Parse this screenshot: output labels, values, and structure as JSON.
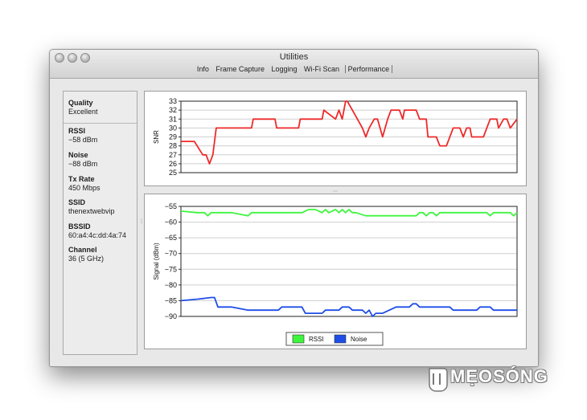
{
  "window": {
    "title": "Utilities",
    "tabs": [
      "Info",
      "Frame Capture",
      "Logging",
      "Wi-Fi Scan",
      "Performance"
    ],
    "active_tab": "Performance"
  },
  "sidebar": {
    "quality": {
      "label": "Quality",
      "value": "Excellent"
    },
    "items": [
      {
        "label": "RSSI",
        "value": "−58 dBm"
      },
      {
        "label": "Noise",
        "value": "−88 dBm"
      },
      {
        "label": "Tx Rate",
        "value": "450 Mbps"
      },
      {
        "label": "SSID",
        "value": "thenextwebvip"
      },
      {
        "label": "BSSID",
        "value": "60:a4:4c:dd:4a:74"
      },
      {
        "label": "Channel",
        "value": "36 (5 GHz)"
      }
    ]
  },
  "chart_data": [
    {
      "type": "line",
      "ylabel": "SNR",
      "ylim": [
        25,
        33
      ],
      "yticks": [
        25,
        26,
        27,
        28,
        29,
        30,
        31,
        32,
        33
      ],
      "grid": true,
      "series": [
        {
          "color": "#ee2a2a",
          "x": [
            0,
            4,
            6.5,
            7.5,
            8.5,
            9.5,
            10.5,
            14,
            21,
            21.5,
            28,
            28.5,
            35,
            35.5,
            42,
            42.5,
            46,
            47,
            48,
            49,
            49.5,
            51,
            52.5,
            54,
            55,
            56,
            57.5,
            58.5,
            60,
            61.5,
            62.5,
            64,
            65,
            66,
            66.5,
            70,
            71,
            73,
            73.5,
            76,
            77,
            79,
            81,
            81.5,
            83,
            84,
            85,
            86,
            86.5,
            90,
            91,
            92,
            93,
            94,
            94.5,
            96,
            97,
            98,
            100
          ],
          "y": [
            28.5,
            28.5,
            27,
            27,
            26,
            27,
            30,
            30,
            30,
            31,
            31,
            30,
            30,
            31,
            31,
            32,
            31,
            32,
            31,
            33,
            33,
            32,
            31,
            30,
            29,
            30,
            31,
            31,
            29,
            31,
            32,
            32,
            32,
            31,
            32,
            32,
            31,
            31,
            29,
            29,
            28,
            28,
            30,
            30,
            30,
            29,
            30,
            30,
            29,
            29,
            30,
            31,
            31,
            31,
            30,
            31,
            31,
            30,
            31
          ]
        }
      ]
    },
    {
      "type": "line",
      "ylabel": "Signal (dBm)",
      "ylim": [
        -90,
        -55
      ],
      "yticks": [
        -55,
        -60,
        -65,
        -70,
        -75,
        -80,
        -85,
        -90
      ],
      "grid": true,
      "legend_position": "bottom-center",
      "series": [
        {
          "name": "RSSI",
          "color": "#3ef53e",
          "x": [
            0,
            5,
            7,
            8,
            9,
            10,
            15,
            20,
            21,
            22,
            36,
            38,
            40,
            42,
            43,
            44,
            46,
            47,
            48,
            49,
            50,
            51,
            52,
            55,
            56,
            70,
            71,
            72,
            73,
            74,
            75,
            76,
            77,
            78,
            79,
            80,
            81,
            90,
            91,
            92,
            93,
            98,
            99,
            100
          ],
          "y": [
            -56.5,
            -57,
            -57,
            -58,
            -57,
            -57,
            -57,
            -58,
            -57,
            -57,
            -57,
            -56,
            -56,
            -57,
            -56,
            -57,
            -56,
            -57,
            -56,
            -57,
            -56,
            -57,
            -57,
            -58,
            -58,
            -58,
            -57,
            -57,
            -58,
            -57,
            -57,
            -58,
            -57,
            -57,
            -57,
            -57,
            -57,
            -57,
            -57,
            -58,
            -57,
            -57,
            -58,
            -57
          ]
        },
        {
          "name": "Noise",
          "color": "#1f4de8",
          "x": [
            0,
            5,
            9,
            10,
            11,
            15,
            20,
            29,
            30,
            36,
            37,
            42,
            43,
            47,
            48,
            50,
            51,
            54,
            55,
            56,
            57,
            58,
            60,
            64,
            65,
            66,
            68,
            69,
            70,
            71,
            80,
            81,
            88,
            89,
            92,
            93,
            97,
            98,
            100
          ],
          "y": [
            -85,
            -84.5,
            -84,
            -84,
            -87,
            -87,
            -88,
            -88,
            -87,
            -87,
            -89,
            -89,
            -88,
            -88,
            -87,
            -87,
            -88,
            -88,
            -89,
            -88,
            -90,
            -89,
            -89,
            -87,
            -87,
            -87,
            -87,
            -86,
            -86,
            -87,
            -87,
            -88,
            -88,
            -87,
            -87,
            -88,
            -88,
            -88,
            -88
          ]
        }
      ]
    }
  ],
  "watermark": "MẸOSÓNG"
}
